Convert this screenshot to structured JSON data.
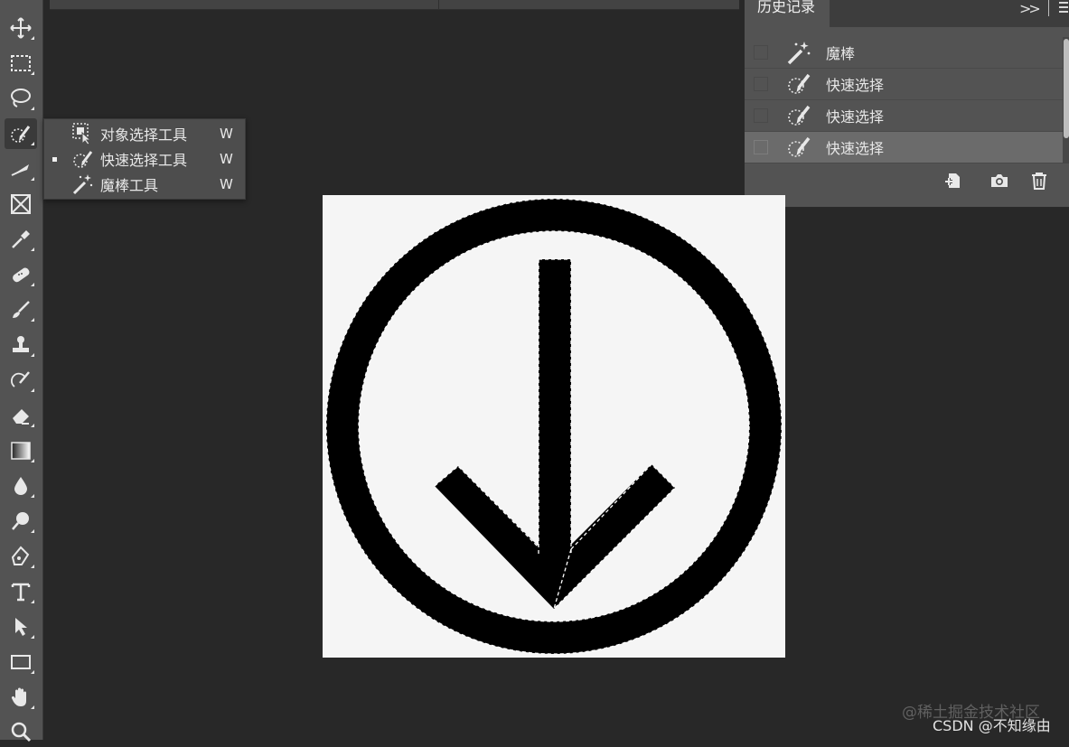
{
  "flyout": {
    "items": [
      {
        "label": "对象选择工具",
        "key": "W",
        "icon": "object-selection-icon",
        "active": false
      },
      {
        "label": "快速选择工具",
        "key": "W",
        "icon": "quick-selection-icon",
        "active": true
      },
      {
        "label": "魔棒工具",
        "key": "W",
        "icon": "magic-wand-icon",
        "active": false
      }
    ]
  },
  "history": {
    "tab_label": "历史记录",
    "collapse_symbol": ">>",
    "items": [
      {
        "label": "魔棒",
        "icon": "magic-wand-icon"
      },
      {
        "label": "快速选择",
        "icon": "quick-selection-icon"
      },
      {
        "label": "快速选择",
        "icon": "quick-selection-icon"
      },
      {
        "label": "快速选择",
        "icon": "quick-selection-icon",
        "selected": true
      }
    ]
  },
  "watermark": {
    "line1": "@稀土掘金技术社区",
    "line2": "CSDN @不知缘由"
  },
  "colors": {
    "toolbar": "#535353",
    "workspace": "#282828",
    "panel": "#535353",
    "selected_row": "#6b6b6b",
    "canvas": "#f5f5f5"
  }
}
